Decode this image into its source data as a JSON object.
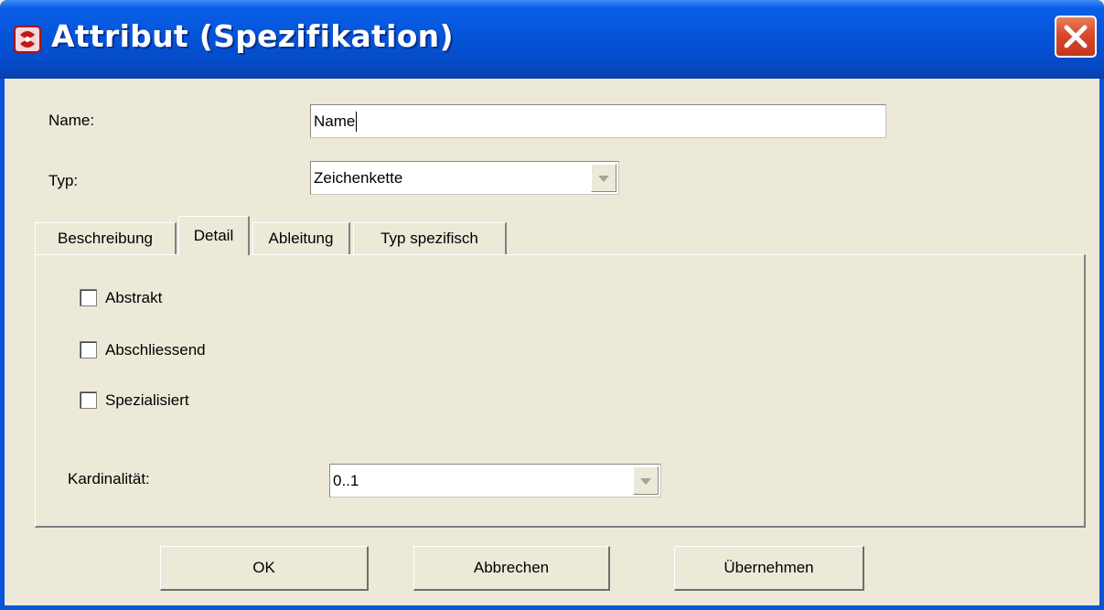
{
  "window": {
    "title": "Attribut (Spezifikation)",
    "icon": "app-icon",
    "close_icon": "close-icon"
  },
  "form": {
    "name_label": "Name:",
    "name_value": "Name",
    "type_label": "Typ:",
    "type_value": "Zeichenkette"
  },
  "tabs": [
    {
      "label": "Beschreibung",
      "active": false
    },
    {
      "label": "Detail",
      "active": true
    },
    {
      "label": "Ableitung",
      "active": false
    },
    {
      "label": "Typ spezifisch",
      "active": false
    }
  ],
  "detail": {
    "checkboxes": [
      {
        "label": "Abstrakt",
        "checked": false
      },
      {
        "label": "Abschliessend",
        "checked": false
      },
      {
        "label": "Spezialisiert",
        "checked": false
      }
    ],
    "cardinality_label": "Kardinalität:",
    "cardinality_value": "0..1"
  },
  "buttons": {
    "ok": "OK",
    "cancel": "Abbrechen",
    "apply": "Übernehmen"
  },
  "colors": {
    "titlebar": "#0453d8",
    "dialog_bg": "#ece9d8",
    "close_button": "#d9482b"
  }
}
